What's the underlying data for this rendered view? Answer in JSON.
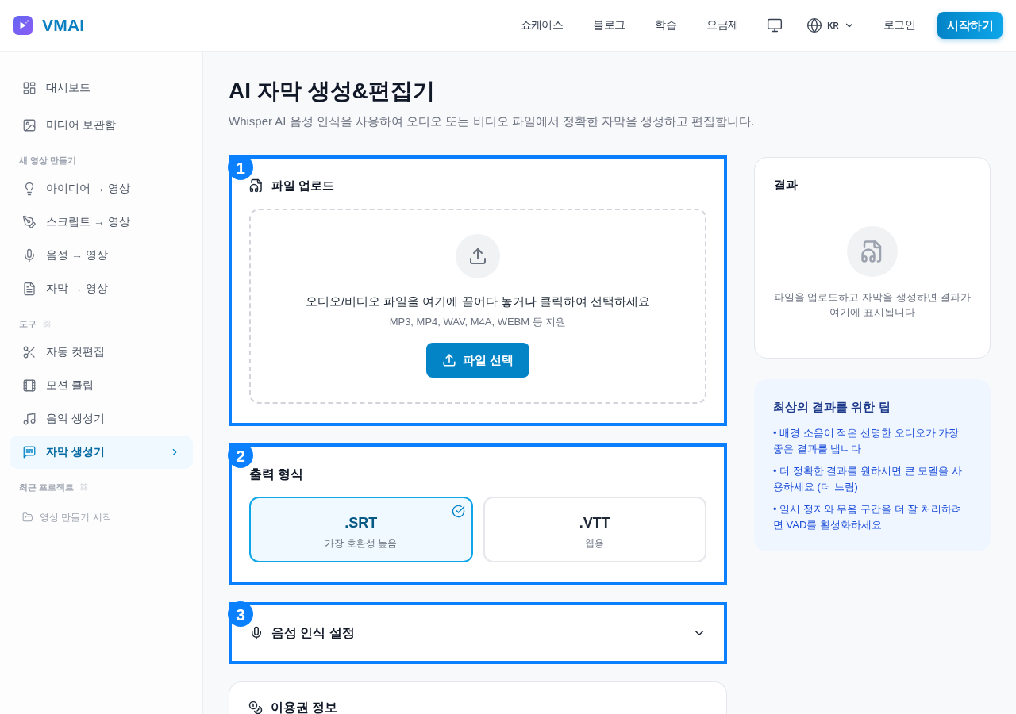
{
  "header": {
    "brand": "VMAI",
    "nav": [
      "쇼케이스",
      "블로그",
      "학습",
      "요금제"
    ],
    "language": "KR",
    "login": "로그인",
    "cta": "시작하기"
  },
  "sidebar": {
    "items": [
      {
        "label": "대시보드",
        "selected": false
      },
      {
        "label": "미디어 보관함",
        "selected": false
      }
    ],
    "sections": [
      {
        "kind": "create",
        "title": "새 영상 만들기",
        "items": [
          {
            "label": "아이디어 → 영상",
            "selected": false
          },
          {
            "label": "스크립트 → 영상",
            "selected": false
          },
          {
            "label": "음성 → 영상",
            "selected": false
          },
          {
            "label": "자막 → 영상",
            "selected": false
          }
        ]
      },
      {
        "kind": "tools",
        "title": "도구",
        "items": [
          {
            "label": "자동 컷편집",
            "selected": false
          },
          {
            "label": "모션 클립",
            "selected": false
          },
          {
            "label": "음악 생성기",
            "selected": false
          },
          {
            "label": "자막 생성기",
            "selected": true
          }
        ]
      },
      {
        "kind": "recent",
        "title": "최근 프로젝트",
        "items": [
          {
            "label": "영상 만들기 시작",
            "selected": false
          }
        ]
      }
    ]
  },
  "page": {
    "title": "AI 자막 생성&편집기",
    "subtitle": "Whisper AI 음성 인식을 사용하여 오디오 또는 비디오 파일에서 정확한 자막을 생성하고 편집합니다."
  },
  "cards": [
    {
      "kind": "upload",
      "callout": "1",
      "title": "파일 업로드",
      "drop_text": "오디오/비디오 파일을 여기에 끌어다 놓거나 클릭하여 선택하세요",
      "formats": "MP3, MP4, WAV, M4A, WEBM 등 지원",
      "button": "파일 선택"
    },
    {
      "kind": "format",
      "callout": "2",
      "title": "출력 형식",
      "options": [
        {
          "label": ".SRT",
          "caption": "가장 호환성 높음",
          "selected": true
        },
        {
          "label": ".VTT",
          "caption": "웹용",
          "selected": false
        }
      ]
    },
    {
      "kind": "settings",
      "callout": "3",
      "title": "음성 인식 설정",
      "expanded": false
    },
    {
      "kind": "usage",
      "title": "이용권 정보"
    }
  ],
  "result": {
    "title": "결과",
    "empty_text": "파일을 업로드하고 자막을 생성하면 결과가 여기에 표시됩니다"
  },
  "tips": {
    "title": "최상의 결과를 위한 팁",
    "items": [
      "• 배경 소음이 적은 선명한 오디오가 가장 좋은 결과를 냅니다",
      "• 더 정확한 결과를 원하시면 큰 모델을 사용하세요 (더 느림)",
      "• 일시 정지와 무음 구간을 더 잘 처리하려면 VAD를 활성화하세요"
    ]
  }
}
